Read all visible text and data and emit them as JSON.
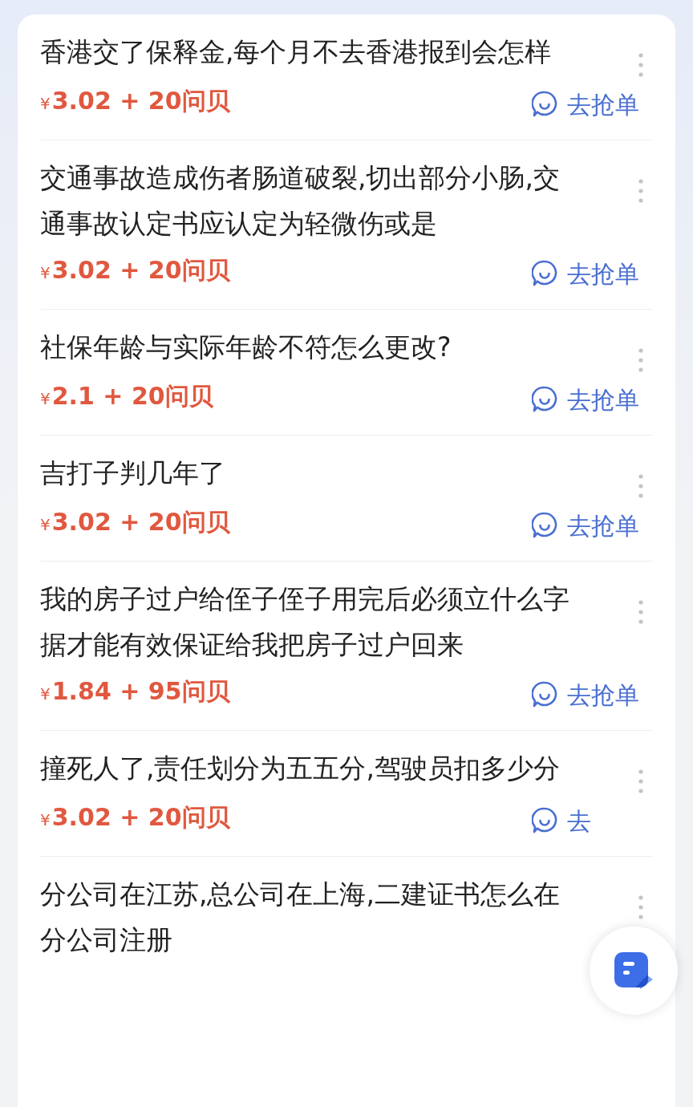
{
  "questions": [
    {
      "title": "香港交了保释金,每个月不去香港报到会怎样",
      "currency": "¥",
      "reward": "3.02 + 20问贝",
      "action": "去抢单"
    },
    {
      "title": "交通事故造成伤者肠道破裂,切出部分小肠,交通事故认定书应认定为轻微伤或是",
      "currency": "¥",
      "reward": "3.02 + 20问贝",
      "action": "去抢单"
    },
    {
      "title": "社保年龄与实际年龄不符怎么更改?",
      "currency": "¥",
      "reward": "2.1 + 20问贝",
      "action": "去抢单"
    },
    {
      "title": "吉打子判几年了",
      "currency": "¥",
      "reward": "3.02 + 20问贝",
      "action": "去抢单"
    },
    {
      "title": "我的房子过户给侄子侄子用完后必须立什么字据才能有效保证给我把房子过户回来",
      "currency": "¥",
      "reward": "1.84 + 95问贝",
      "action": "去抢单"
    },
    {
      "title": "撞死人了,责任划分为五五分,驾驶员扣多少分",
      "currency": "¥",
      "reward": "3.02 + 20问贝",
      "action": "去"
    },
    {
      "title": "分公司在江苏,总公司在上海,二建证书怎么在分公司注册"
    }
  ],
  "floating_button": {
    "shown": true
  }
}
